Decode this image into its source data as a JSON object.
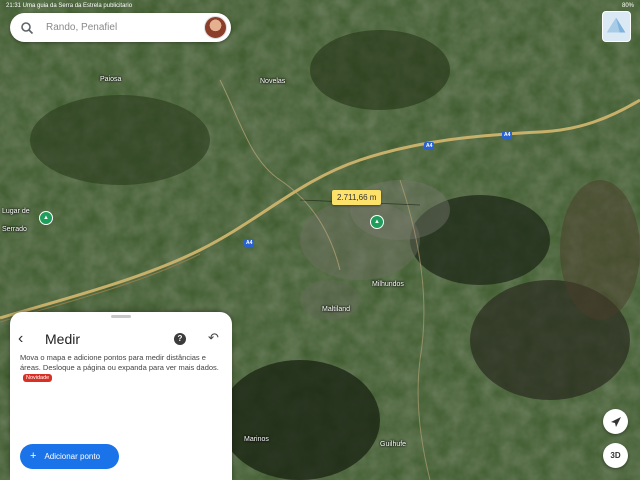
{
  "status_bar": {
    "left_text": "21:31 Uma guia da Serra da Estrela publicitario",
    "right_text": "80%"
  },
  "search": {
    "placeholder": "Rando, Penafiel"
  },
  "icons": {
    "search": "search-icon",
    "layers": "layers-icon",
    "back": "back-arrow-icon",
    "help": "help-icon",
    "undo": "undo-icon",
    "add": "plus-icon",
    "compass": "compass-icon"
  },
  "map": {
    "labels": {
      "novelas": "Novelas",
      "paiosa": "Paiosa",
      "lugar": "Lugar de",
      "serrado": "Serrado",
      "maltiland": "Maltiland",
      "milhundos": "Milhundos",
      "marinos": "Marinos",
      "guilhufe": "Guilhufe"
    },
    "road_shields": {
      "a4_east": "A4",
      "a4_center": "A4",
      "a4_west": "A4"
    },
    "distance": "2.711,66 m"
  },
  "measure_panel": {
    "title": "Medir",
    "description": "Mova o mapa e adicione pontos para medir distâncias e áreas. Desloque a página ou expanda para ver mais dados.",
    "badge": "Novidade",
    "add_button": "Adicionar ponto"
  },
  "controls": {
    "three_d": "3D"
  },
  "colors": {
    "accent": "#1a73e8",
    "measure_line": "#fce16a",
    "badge": "#d93025"
  }
}
